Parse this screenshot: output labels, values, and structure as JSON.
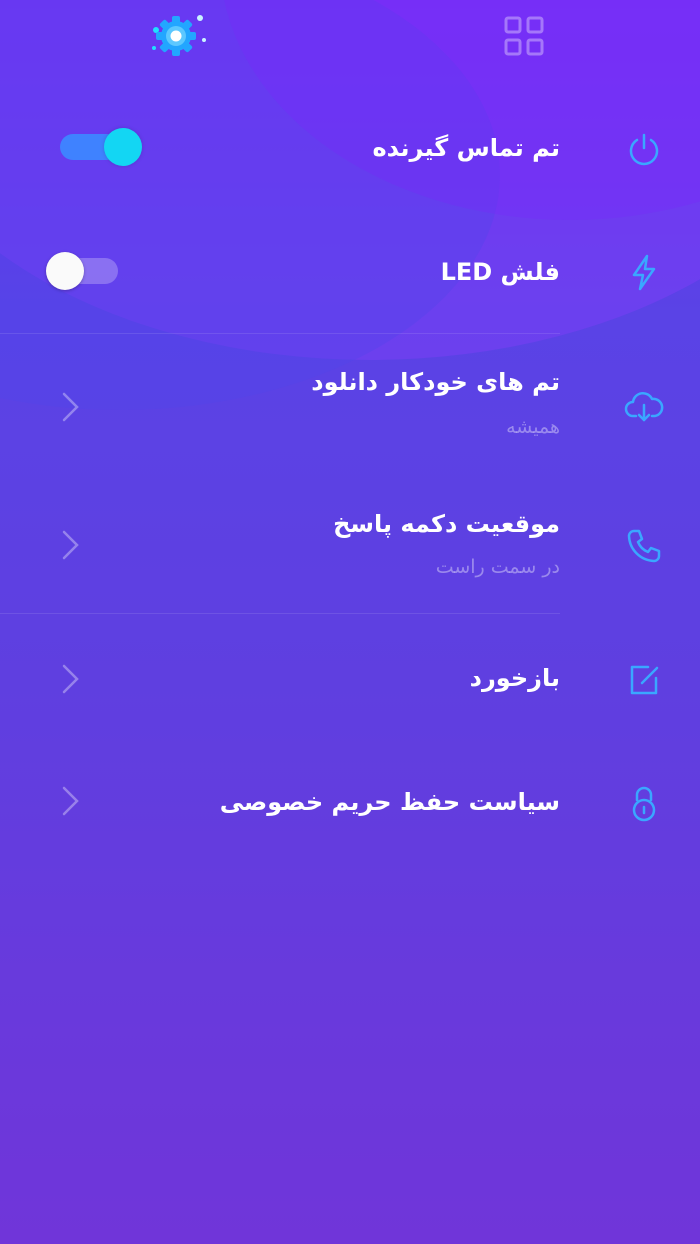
{
  "colors": {
    "accent": "#3aa7ff",
    "toggle_on_track": "#3f82ff",
    "toggle_on_knob": "#13d6f3"
  },
  "header": {
    "logo_icon": "settings-gear-logo-icon",
    "grid_icon": "grid-icon"
  },
  "items": [
    {
      "id": "caller-theme",
      "title": "تم تماس گیرنده",
      "icon": "power-icon",
      "toggle": true,
      "value": "on"
    },
    {
      "id": "led-flash",
      "title": "فلش LED",
      "icon": "lightning-icon",
      "toggle": true,
      "value": "off"
    },
    {
      "id": "auto-download",
      "title": "تم های خودکار دانلود",
      "subtitle": "همیشه",
      "icon": "cloud-download-icon"
    },
    {
      "id": "answer-button",
      "title": "موقعیت دکمه پاسخ",
      "subtitle": "در سمت راست",
      "icon": "phone-icon"
    },
    {
      "id": "feedback",
      "title": "بازخورد",
      "icon": "edit-icon"
    },
    {
      "id": "privacy",
      "title": "سیاست حفظ حریم خصوصی",
      "icon": "lock-icon"
    }
  ]
}
